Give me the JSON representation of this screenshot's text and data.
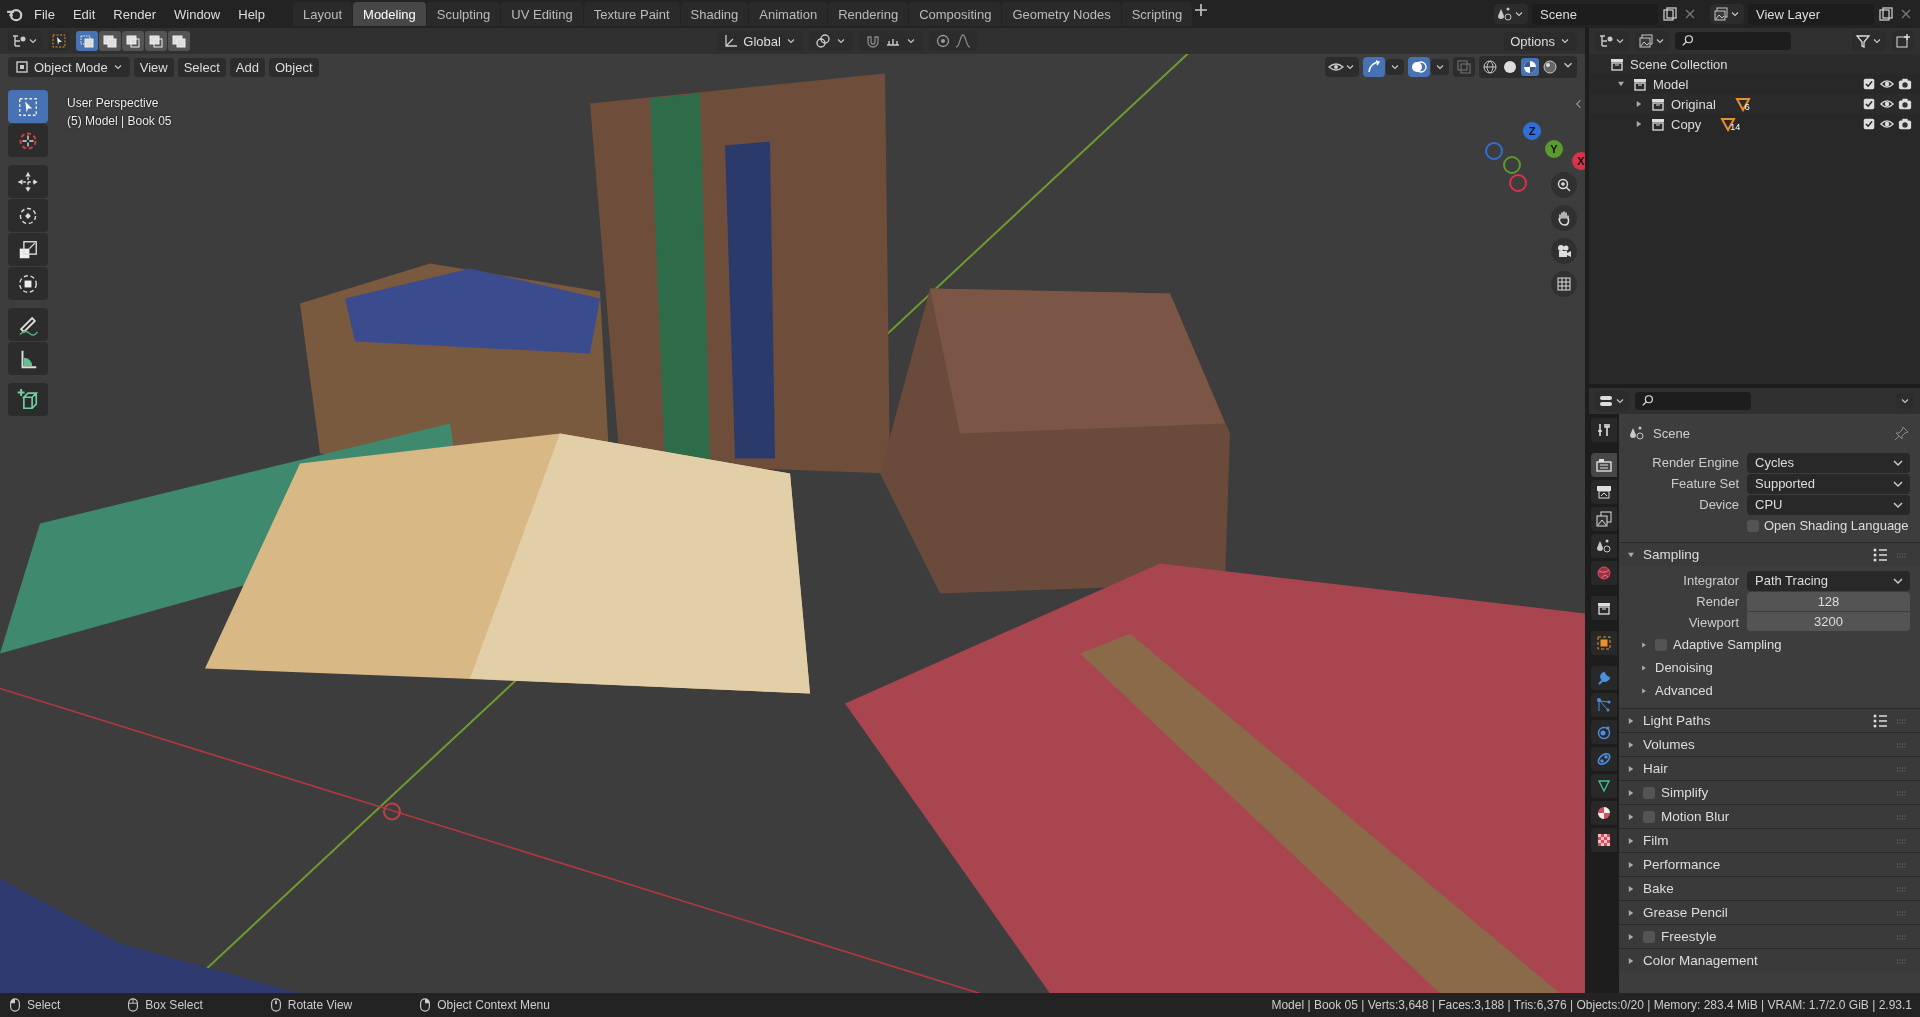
{
  "menu": [
    {
      "label": "File"
    },
    {
      "label": "Edit"
    },
    {
      "label": "Render"
    },
    {
      "label": "Window"
    },
    {
      "label": "Help"
    }
  ],
  "workspaces": [
    {
      "label": "Layout",
      "selected": false
    },
    {
      "label": "Modeling",
      "selected": true
    },
    {
      "label": "Sculpting",
      "selected": false
    },
    {
      "label": "UV Editing",
      "selected": false
    },
    {
      "label": "Texture Paint",
      "selected": false
    },
    {
      "label": "Shading",
      "selected": false
    },
    {
      "label": "Animation",
      "selected": false
    },
    {
      "label": "Rendering",
      "selected": false
    },
    {
      "label": "Compositing",
      "selected": false
    },
    {
      "label": "Geometry Nodes",
      "selected": false
    },
    {
      "label": "Scripting",
      "selected": false
    }
  ],
  "scene_selector": {
    "value": "Scene"
  },
  "view_layer_selector": {
    "value": "View Layer"
  },
  "tool_header": {
    "select_modes": [
      {
        "kind": "set",
        "selected": true
      },
      {
        "kind": "extend",
        "selected": false
      },
      {
        "kind": "subtract",
        "selected": false
      },
      {
        "kind": "invert",
        "selected": false
      },
      {
        "kind": "intersect",
        "selected": false
      }
    ],
    "transform_orientation": "Global",
    "options": "Options"
  },
  "viewport_header": {
    "mode": "Object Mode",
    "menus": [
      "View",
      "Select",
      "Add",
      "Object"
    ],
    "gizmos_on": true,
    "overlays_on": true,
    "shading": [
      {
        "kind": "wireframe",
        "selected": false
      },
      {
        "kind": "solid",
        "selected": false
      },
      {
        "kind": "material",
        "selected": true
      },
      {
        "kind": "rendered",
        "selected": false
      }
    ]
  },
  "viewport": {
    "view_name": "User Perspective",
    "object_info": "(5) Model | Book 05",
    "gizmo": [
      {
        "label": "Z",
        "color": "#2e70d8"
      },
      {
        "label": "Y",
        "color": "#5b9a2c"
      },
      {
        "label": "X",
        "color": "#d8334a"
      }
    ]
  },
  "toolbar": [
    {
      "kind": "select",
      "selected": true
    },
    {
      "kind": "cursor",
      "selected": false
    },
    {
      "kind": "move",
      "selected": false
    },
    {
      "kind": "rotate",
      "selected": false
    },
    {
      "kind": "scale",
      "selected": false
    },
    {
      "kind": "transform",
      "selected": false
    },
    {
      "kind": "annotate",
      "selected": false
    },
    {
      "kind": "measure",
      "selected": false
    },
    {
      "kind": "add_cube",
      "selected": false
    }
  ],
  "outliner": {
    "root": "Scene Collection",
    "children": [
      {
        "label": "Model",
        "expanded": true,
        "checked": true,
        "children": [
          {
            "label": "Original",
            "expanded": false,
            "checked": true,
            "mesh_count": "6"
          },
          {
            "label": "Copy",
            "expanded": false,
            "checked": true,
            "mesh_count": "14"
          }
        ]
      }
    ]
  },
  "properties": {
    "tabs": [
      {
        "kind": "tool",
        "selected": false
      },
      {
        "kind": "render",
        "selected": true
      },
      {
        "kind": "output",
        "selected": false
      },
      {
        "kind": "view_layer",
        "selected": false
      },
      {
        "kind": "scene",
        "selected": false
      },
      {
        "kind": "world",
        "selected": false
      },
      {
        "kind": "collection",
        "selected": false
      },
      {
        "kind": "object",
        "selected": false
      },
      {
        "kind": "modifiers",
        "selected": false
      },
      {
        "kind": "particles",
        "selected": false
      },
      {
        "kind": "physics",
        "selected": false
      },
      {
        "kind": "constraints",
        "selected": false
      },
      {
        "kind": "data",
        "selected": false
      },
      {
        "kind": "material",
        "selected": false
      },
      {
        "kind": "texture",
        "selected": false
      }
    ],
    "context": "Scene",
    "fields": [
      {
        "kind": "dropdown",
        "label": "Render Engine",
        "value": "Cycles"
      },
      {
        "kind": "dropdown",
        "label": "Feature Set",
        "value": "Supported"
      },
      {
        "kind": "dropdown",
        "label": "Device",
        "value": "CPU"
      },
      {
        "kind": "checkbox",
        "label": "Open Shading Language",
        "checked": false
      }
    ],
    "panels": [
      {
        "label": "Sampling",
        "expanded": true,
        "presets": true,
        "fields": [
          {
            "kind": "dropdown",
            "label": "Integrator",
            "value": "Path Tracing"
          },
          {
            "kind": "number",
            "label": "Render",
            "value": "128"
          },
          {
            "kind": "number",
            "label": "Viewport",
            "value": "3200"
          }
        ],
        "subpanels": [
          {
            "label": "Adaptive Sampling",
            "checked": false
          },
          {
            "label": "Denoising"
          },
          {
            "label": "Advanced"
          }
        ]
      },
      {
        "label": "Light Paths",
        "expanded": false,
        "presets": true
      },
      {
        "label": "Volumes",
        "expanded": false,
        "presets": false
      },
      {
        "label": "Hair",
        "expanded": false,
        "presets": false
      },
      {
        "label": "Simplify",
        "expanded": false,
        "presets": false,
        "checked": false
      },
      {
        "label": "Motion Blur",
        "expanded": false,
        "presets": false,
        "checked": false
      },
      {
        "label": "Film",
        "expanded": false,
        "presets": false
      },
      {
        "label": "Performance",
        "expanded": false,
        "presets": false
      },
      {
        "label": "Bake",
        "expanded": false,
        "presets": false
      },
      {
        "label": "Grease Pencil",
        "expanded": false,
        "presets": false
      },
      {
        "label": "Freestyle",
        "expanded": false,
        "presets": false,
        "checked": false
      },
      {
        "label": "Color Management",
        "expanded": false,
        "presets": false
      }
    ]
  },
  "status_bar": {
    "hints": [
      "Select",
      "Box Select",
      "Rotate View",
      "Object Context Menu"
    ],
    "stats": "Model | Book 05 | Verts:3,648 | Faces:3,188 | Tris:6,376 | Objects:0/20 | Memory: 283.4 MiB | VRAM: 1.7/2.0 GiB | 2.93.1"
  }
}
